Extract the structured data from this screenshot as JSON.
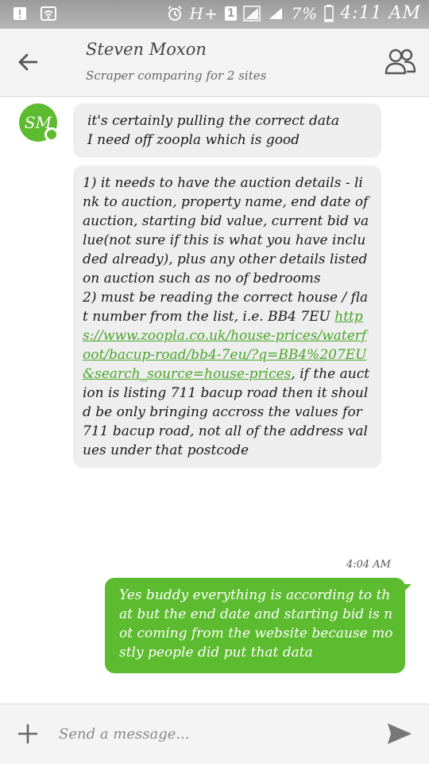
{
  "status_bar": {
    "network": "H+",
    "sim": "1",
    "battery": "7%",
    "time": "4:11 AM"
  },
  "header": {
    "contact_name": "Steven Moxon",
    "subtitle": "Scraper comparing for 2 sites"
  },
  "avatar": {
    "initials": "SM"
  },
  "messages": [
    {
      "direction": "incoming",
      "text": "it's certainly pulling the correct data\nI need off zoopla which is good"
    },
    {
      "direction": "incoming",
      "text_before": "1) it needs to have the auction details - link to auction, property name, end date of auction, starting bid value, current bid value(not sure if this is what you have included already), plus any other details listed on auction such as no of bedrooms\n2) must be reading the correct house / flat number from the list, i.e. BB4 7EU ",
      "link": "https://www.zoopla.co.uk/house-prices/waterfoot/bacup-road/bb4-7eu/?q=BB4%207EU&search_source=house-prices",
      "text_after": ", if the auction is listing 711 bacup road then it should be only bringing accross the values for 711 bacup road, not all of the address values under that postcode"
    },
    {
      "direction": "outgoing",
      "timestamp": "4:04 AM",
      "text": "Yes buddy everything is according to that but the end date and starting bid is not coming from the website because mostly people did put that data"
    }
  ],
  "compose": {
    "placeholder": "Send a message..."
  },
  "colors": {
    "accent_green": "#5dbb2f",
    "link_green": "#4aa52a",
    "incoming_bubble": "#eeeeee"
  },
  "icons": [
    "back-arrow-icon",
    "people-icon",
    "plus-icon",
    "send-icon",
    "alarm-icon",
    "wifi-icon",
    "signal-icon",
    "battery-icon"
  ]
}
